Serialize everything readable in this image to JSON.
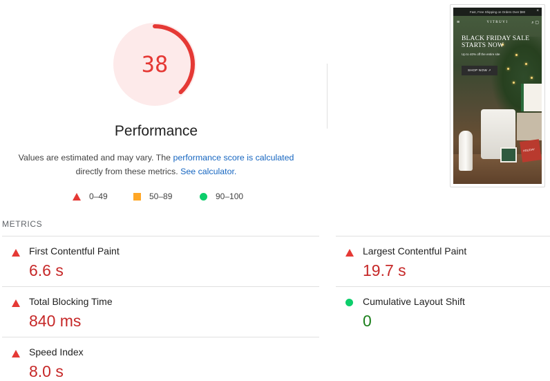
{
  "score": {
    "value": "38",
    "fraction": 0.38,
    "title": "Performance",
    "status_color": "#e53935",
    "bg_color": "#fdeaea"
  },
  "description": {
    "text1": "Values are estimated and may vary. The ",
    "link1": "performance score is calculated",
    "text2": "directly from these metrics. ",
    "link2": "See calculator."
  },
  "legend": [
    {
      "icon": "fail-triangle-icon",
      "range": "0–49"
    },
    {
      "icon": "average-square-icon",
      "range": "50–89"
    },
    {
      "icon": "pass-circle-icon",
      "range": "90–100"
    }
  ],
  "screenshot": {
    "promo": "Fast, Free Shipping on Orders Over $80",
    "brand": "VITRUVI",
    "headline": "BLACK FRIDAY SALE STARTS NOW",
    "subline": "Up to 40% off the entire site",
    "cta": "SHOP NOW ↗",
    "box_label": "HOLIDAY"
  },
  "metrics_title": "METRICS",
  "metrics": [
    {
      "name": "First Contentful Paint",
      "value": "6.6 s",
      "status": "fail"
    },
    {
      "name": "Largest Contentful Paint",
      "value": "19.7 s",
      "status": "fail"
    },
    {
      "name": "Total Blocking Time",
      "value": "840 ms",
      "status": "fail"
    },
    {
      "name": "Cumulative Layout Shift",
      "value": "0",
      "status": "pass"
    },
    {
      "name": "Speed Index",
      "value": "8.0 s",
      "status": "fail"
    }
  ]
}
